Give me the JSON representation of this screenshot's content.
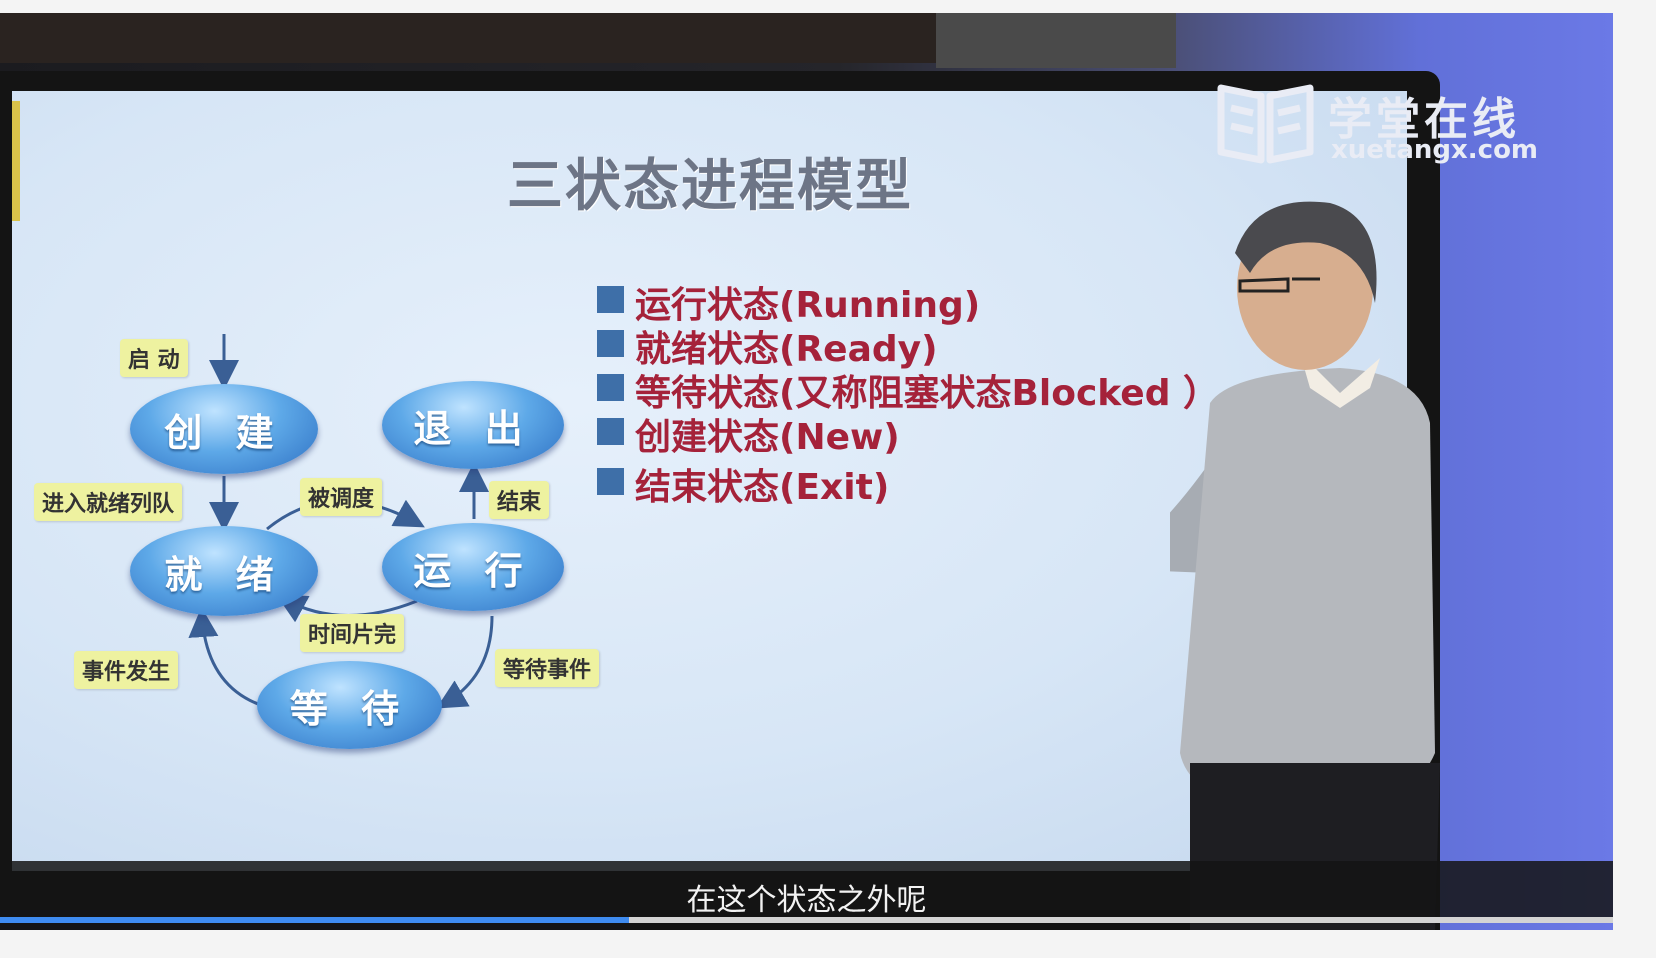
{
  "slide": {
    "title": "三状态进程模型",
    "bullets": [
      "运行状态(Running)",
      "就绪状态(Ready)",
      "等待状态(又称阻塞状态Blocked ）",
      "创建状态(New)",
      "结束状态(Exit)"
    ],
    "diagram": {
      "states": {
        "create": "创 建",
        "exit": "退 出",
        "ready": "就 绪",
        "running": "运 行",
        "waiting": "等 待"
      },
      "transitions": {
        "start": "启 动",
        "enter_ready_queue": "进入就绪列队",
        "scheduled": "被调度",
        "finish": "结束",
        "time_slice_done": "时间片完",
        "event_occurs": "事件发生",
        "wait_event": "等待事件"
      }
    }
  },
  "watermark": {
    "name_cn": "学堂在线",
    "domain": "xuetangx.com"
  },
  "player": {
    "subtitle": "在这个状态之外呢",
    "progress_fraction": 0.39
  },
  "colors": {
    "bullet_text": "#a5223a",
    "bullet_square": "#3e6fa8",
    "progress": "#3f8cf0"
  }
}
